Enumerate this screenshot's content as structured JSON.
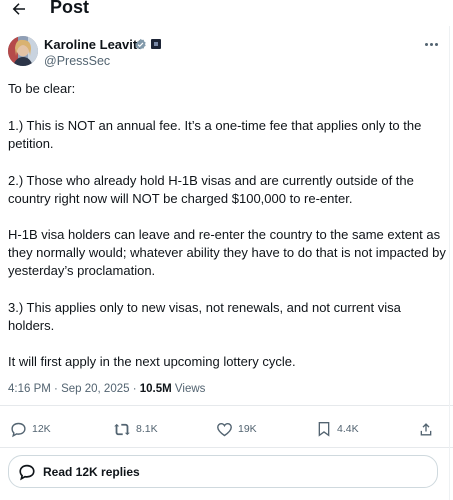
{
  "header": {
    "title": "Post",
    "back_icon": "arrow-left-icon"
  },
  "author": {
    "name": "Karoline Leavitt",
    "handle": "@PressSec",
    "verified_icon": "verified-badge-icon",
    "verified_color": "#829aab",
    "affiliation_icon": "affiliation-badge-icon"
  },
  "post": {
    "paragraphs": [
      "To be clear:",
      "1.) This is NOT an annual fee. It’s a one-time fee that applies only to the petition.",
      "2.) Those who already hold H-1B visas and are currently outside of the country right now will NOT be charged $100,000 to re-enter.",
      "H-1B visa holders can leave and re-enter the country to the same extent as they normally would; whatever ability they have to do that is not impacted by yesterday’s proclamation.",
      "3.) This applies only to new visas, not renewals, and not current visa holders.",
      "It will first apply in the next upcoming lottery cycle."
    ],
    "time": "4:16 PM",
    "separator": "·",
    "date": "Sep 20, 2025",
    "views_count": "10.5M",
    "views_label": "Views"
  },
  "actions": {
    "reply": {
      "icon": "reply-icon",
      "count": "12K"
    },
    "repost": {
      "icon": "repost-icon",
      "count": "8.1K"
    },
    "like": {
      "icon": "heart-icon",
      "count": "19K"
    },
    "bookmark": {
      "icon": "bookmark-icon",
      "count": "4.4K"
    },
    "share": {
      "icon": "share-icon"
    }
  },
  "replies_button": {
    "icon": "speech-bubble-icon",
    "label": "Read 12K replies"
  },
  "colors": {
    "text": "#0f1419",
    "muted": "#536471",
    "border": "#cfd9de"
  }
}
